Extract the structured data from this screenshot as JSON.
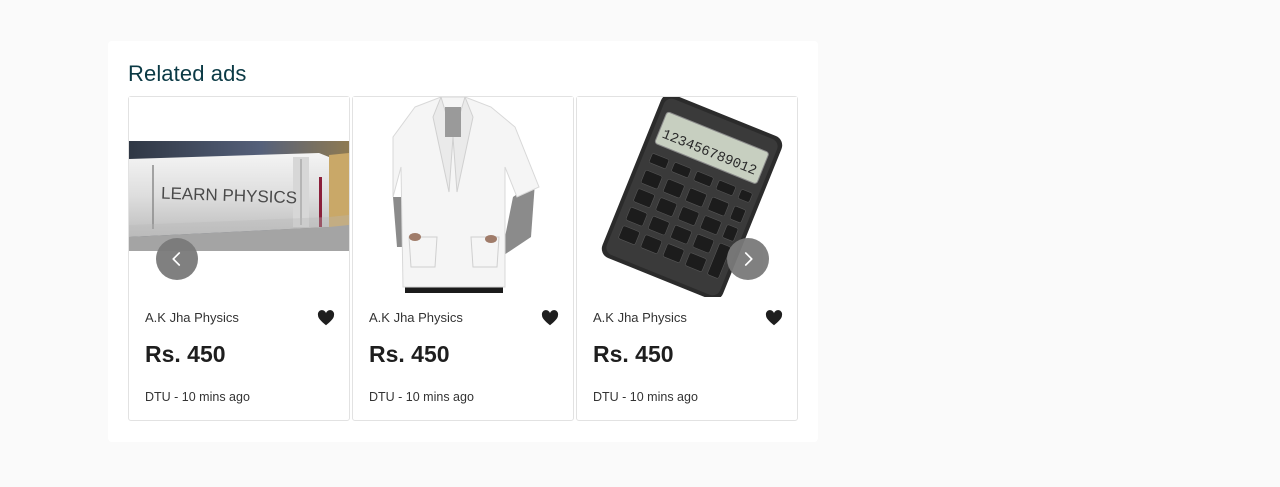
{
  "section": {
    "title": "Related ads"
  },
  "icons": {
    "favorite": "heart-icon",
    "prev": "chevron-left-icon",
    "next": "chevron-right-icon"
  },
  "cards": [
    {
      "seller": "A.K Jha Physics",
      "price": "Rs. 450",
      "meta": "DTU - 10 mins ago",
      "book_text": "LEARN PHYSICS"
    },
    {
      "seller": "A.K Jha Physics",
      "price": "Rs. 450",
      "meta": "DTU - 10 mins ago"
    },
    {
      "seller": "A.K Jha Physics",
      "price": "Rs. 450",
      "meta": "DTU - 10 mins ago",
      "calc_display": "123456789012"
    }
  ],
  "colors": {
    "title": "#0b3a45",
    "nav_button": "#7a7a7a",
    "heart": "#1e1e1e"
  }
}
